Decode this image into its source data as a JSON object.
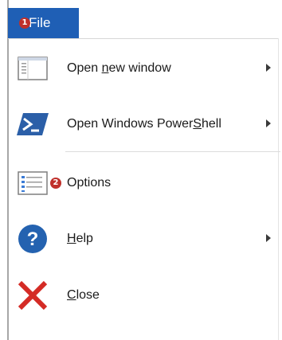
{
  "menubar": {
    "file_label": "File",
    "file_badge": "1"
  },
  "menu": {
    "items": [
      {
        "pre": "Open ",
        "accel": "n",
        "post": "ew window",
        "has_submenu": true,
        "icon": "window-icon"
      },
      {
        "pre": "Open Windows Power",
        "accel": "S",
        "post": "hell",
        "has_submenu": true,
        "icon": "powershell-icon"
      },
      {
        "pre": "",
        "accel": "",
        "post": "Options",
        "has_submenu": false,
        "icon": "options-icon",
        "badge": "2"
      },
      {
        "pre": "",
        "accel": "H",
        "post": "elp",
        "has_submenu": true,
        "icon": "help-icon"
      },
      {
        "pre": "",
        "accel": "C",
        "post": "lose",
        "has_submenu": false,
        "icon": "close-icon"
      }
    ]
  },
  "colors": {
    "file_tab_bg": "#1f5fb5",
    "badge_red": "#c0302b",
    "powershell_blue": "#2b5fa8",
    "help_blue": "#2462b0",
    "close_red": "#d42b25"
  }
}
